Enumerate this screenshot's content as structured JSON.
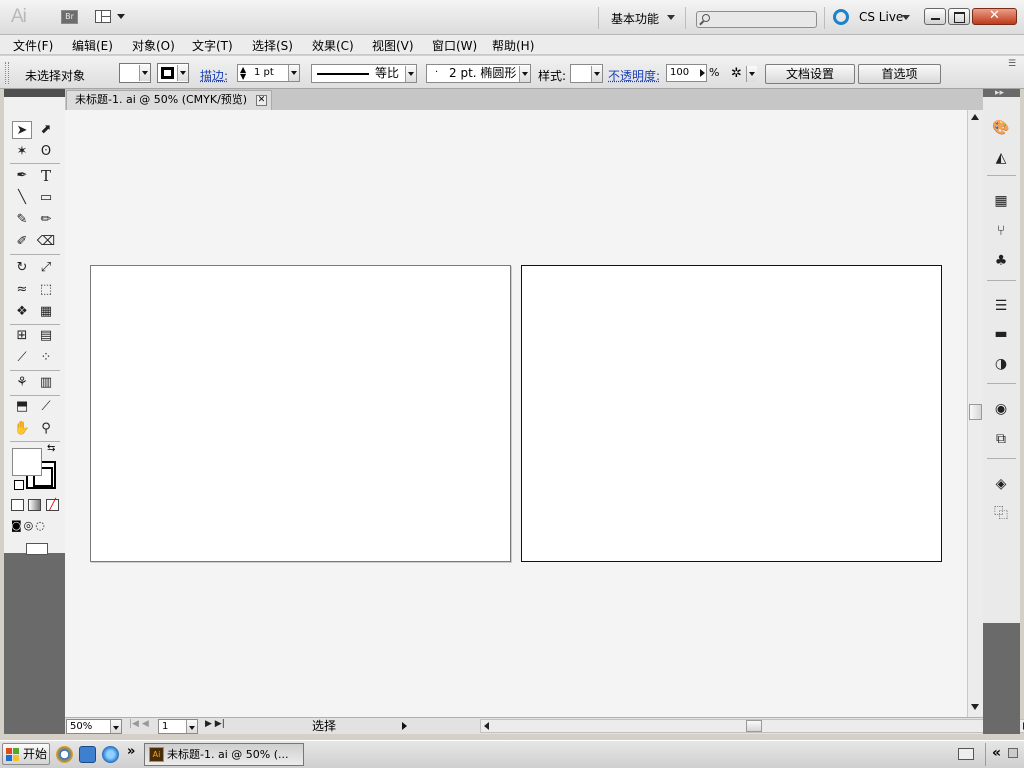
{
  "app": {
    "logo": "Ai",
    "bridge_label": "Br",
    "workspace": "基本功能",
    "search_placeholder": "",
    "cs_live": "CS Live",
    "close_glyph": "✕"
  },
  "menu": [
    "文件(F)",
    "编辑(E)",
    "对象(O)",
    "文字(T)",
    "选择(S)",
    "效果(C)",
    "视图(V)",
    "窗口(W)",
    "帮助(H)"
  ],
  "control": {
    "selection": "未选择对象",
    "stroke_label": "描边:",
    "stroke_value": "1 pt",
    "profile_label": "等比",
    "brush_label": "2 pt. 椭圆形",
    "brush_dot": "·",
    "style_label": "样式:",
    "opacity_label": "不透明度:",
    "opacity_value": "100",
    "opacity_unit": "%",
    "doc_setup": "文档设置",
    "prefs": "首选项"
  },
  "document": {
    "tab_title": "未标题-1. ai @ 50% (CMYK/预览)",
    "tab_close": "✕",
    "artboards": 2
  },
  "status": {
    "zoom": "50%",
    "artboard": "1",
    "tool_readout": "选择"
  },
  "taskbar": {
    "start": "开始",
    "task_icon": "Ai",
    "task": "未标题-1. ai @ 50% (...",
    "more": "»",
    "tray_arrow": "«"
  },
  "colors": {
    "accent": "#1c83c8",
    "canvas": "#f4f4f4",
    "panel_dark": "#6a6a6a"
  }
}
